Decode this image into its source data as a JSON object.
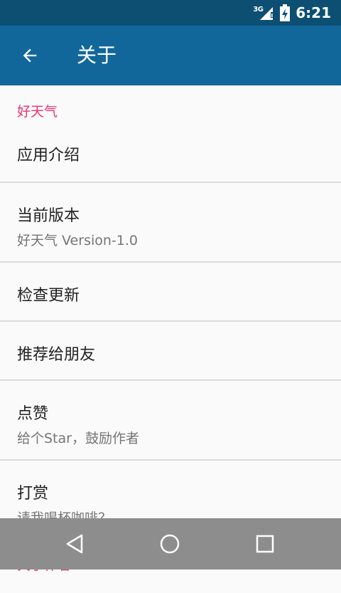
{
  "status_bar": {
    "network": "3G",
    "time": "6:21",
    "icons": [
      "signal-icon",
      "battery-icon"
    ]
  },
  "app_bar": {
    "title": "关于",
    "back_icon": "arrow-back-icon"
  },
  "sections": [
    {
      "category": "好天气",
      "items": [
        {
          "title": "应用介绍"
        },
        {
          "title": "当前版本",
          "summary": "好天气 Version-1.0"
        },
        {
          "title": "检查更新"
        },
        {
          "title": "推荐给朋友"
        },
        {
          "title": "点赞",
          "summary": "给个Star，鼓励作者"
        },
        {
          "title": "打赏",
          "summary": "请我喝杯咖啡？"
        }
      ]
    },
    {
      "category": "关于作者"
    }
  ],
  "nav_bar": {
    "icons": [
      "back-triangle-icon",
      "home-circle-icon",
      "recents-square-icon"
    ]
  },
  "colors": {
    "status_bar": "#0c4f73",
    "app_bar": "#12679a",
    "accent": "#e9336f",
    "nav_bar": "#8d8d8d"
  }
}
